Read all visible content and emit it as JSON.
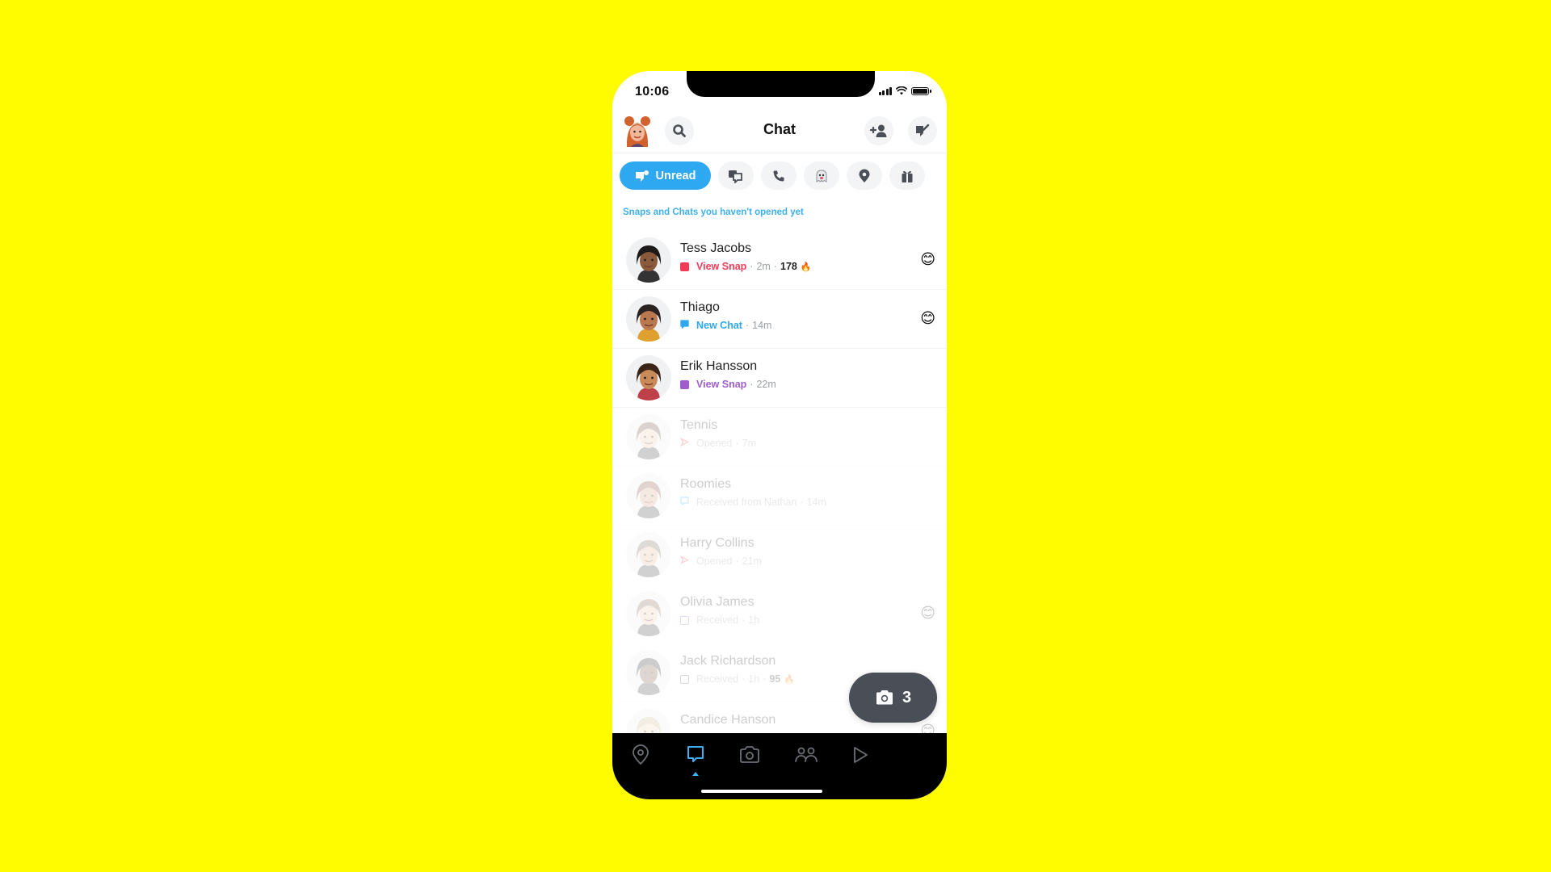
{
  "status_bar": {
    "time": "10:06"
  },
  "header": {
    "title": "Chat"
  },
  "icons": {
    "profile": "bitmoji-avatar",
    "search": "search-icon",
    "add_friend": "add-friend-icon",
    "new_chat": "new-chat-icon"
  },
  "filters": [
    {
      "label": "Unread",
      "icon": "unread-chat-icon",
      "active": true
    },
    {
      "label": "",
      "icon": "groups-icon",
      "active": false
    },
    {
      "label": "",
      "icon": "phone-icon",
      "active": false
    },
    {
      "label": "",
      "icon": "ghost-icon",
      "active": false
    },
    {
      "label": "",
      "icon": "location-pin-icon",
      "active": false
    },
    {
      "label": "",
      "icon": "gift-icon",
      "active": false
    }
  ],
  "subtitle": "Snaps and Chats you haven't opened yet",
  "chats": [
    {
      "name": "Tess Jacobs",
      "status": "View Snap",
      "time": "2m",
      "streak": "178",
      "streak_icon": "🔥",
      "status_color": "#F23C57",
      "status_icon": "filled-square",
      "emoji": "😊",
      "faded": false
    },
    {
      "name": "Thiago",
      "status": "New Chat",
      "time": "14m",
      "streak": "",
      "streak_icon": "",
      "status_color": "#2EA8F0",
      "status_icon": "filled-chat",
      "emoji": "😊",
      "faded": false
    },
    {
      "name": "Erik Hansson",
      "status": "View Snap",
      "time": "22m",
      "streak": "",
      "streak_icon": "",
      "status_color": "#A05DCD",
      "status_icon": "filled-square",
      "emoji": "",
      "faded": false
    },
    {
      "name": "Tennis",
      "status": "Opened",
      "time": "7m",
      "streak": "",
      "streak_icon": "",
      "status_color": "#F23C57",
      "status_icon": "outline-arrow",
      "emoji": "",
      "faded": true
    },
    {
      "name": "Roomies",
      "status": "Received from Nathan",
      "time": "14m",
      "streak": "",
      "streak_icon": "",
      "status_color": "#2EA8F0",
      "status_icon": "outline-chat",
      "emoji": "",
      "faded": true
    },
    {
      "name": "Harry Collins",
      "status": "Opened",
      "time": "21m",
      "streak": "",
      "streak_icon": "",
      "status_color": "#F23C57",
      "status_icon": "outline-arrow",
      "emoji": "",
      "faded": true
    },
    {
      "name": "Olivia James",
      "status": "Received",
      "time": "1h",
      "streak": "",
      "streak_icon": "",
      "status_color": "#A05DCD",
      "status_icon": "outline-square",
      "emoji": "😊",
      "faded": true
    },
    {
      "name": "Jack Richardson",
      "status": "Received",
      "time": "1h",
      "streak": "95",
      "streak_icon": "🔥",
      "status_color": "#555555",
      "status_icon": "outline-square",
      "emoji": "",
      "faded": true
    },
    {
      "name": "Candice Hanson",
      "status": "",
      "time": "",
      "streak": "",
      "streak_icon": "",
      "status_color": "#999999",
      "status_icon": "",
      "emoji": "😊",
      "faded": true
    }
  ],
  "camera_fab": {
    "count": "3",
    "icon": "camera-icon"
  },
  "navbar": {
    "items": [
      {
        "name": "map",
        "icon": "map-pin-icon",
        "active": false
      },
      {
        "name": "chat",
        "icon": "chat-icon",
        "active": true
      },
      {
        "name": "camera",
        "icon": "camera-icon",
        "active": false
      },
      {
        "name": "stories",
        "icon": "friends-icon",
        "active": false
      },
      {
        "name": "spotlight",
        "icon": "play-icon",
        "active": false
      }
    ]
  },
  "colors": {
    "background": "#FFFC00",
    "accent_blue": "#2EA8F0",
    "snap_red": "#F23C57",
    "snap_purple": "#A05DCD",
    "fab_gray": "#4A4F57"
  }
}
